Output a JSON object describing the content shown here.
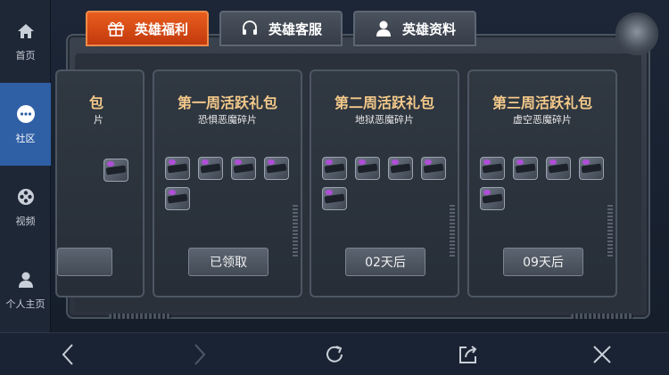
{
  "sidebar": {
    "items": [
      {
        "label": "首页",
        "icon": "home-icon",
        "active": false
      },
      {
        "label": "社区",
        "icon": "chat-bubble-icon",
        "active": true
      },
      {
        "label": "视频",
        "icon": "film-reel-icon",
        "active": false
      },
      {
        "label": "个人主页",
        "icon": "person-icon",
        "active": false
      }
    ]
  },
  "tabs": [
    {
      "label": "英雄福利",
      "icon": "gift-icon",
      "active": true
    },
    {
      "label": "英雄客服",
      "icon": "headset-icon",
      "active": false
    },
    {
      "label": "英雄资料",
      "icon": "user-icon",
      "active": false
    }
  ],
  "cards": [
    {
      "title": "第一周活跃礼包",
      "subtitle": "恐惧恶魔碎片",
      "item_count": 5,
      "button": "已领取"
    },
    {
      "title": "第二周活跃礼包",
      "subtitle": "地狱恶魔碎片",
      "item_count": 5,
      "button": "02天后"
    },
    {
      "title": "第三周活跃礼包",
      "subtitle": "虚空恶魔碎片",
      "item_count": 5,
      "button": "09天后"
    }
  ],
  "partial_card": {
    "title_fragment": "包",
    "sub_fragment": "片",
    "item_count": 1
  },
  "bottombar": {
    "buttons": [
      "back-icon",
      "forward-icon",
      "refresh-icon",
      "share-icon",
      "close-icon"
    ]
  },
  "colors": {
    "accent_tab": "#e85d1e",
    "title_gold": "#f4c98a",
    "sidebar_active": "#2f5fa5"
  }
}
